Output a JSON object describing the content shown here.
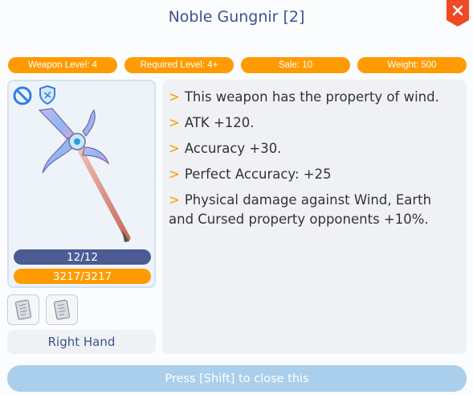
{
  "item": {
    "name": "Noble Gungnir [2]"
  },
  "stats": {
    "weapon_level": "Weapon Level: 4",
    "required_level": "Required Level: 4+",
    "sale": "Sale: 10",
    "weight": "Weight: 500"
  },
  "bars": {
    "refine": "12/12",
    "durability": "3217/3217"
  },
  "equip_position": "Right Hand",
  "description": [
    {
      "marker": ">",
      "text": "This weapon has the property of wind."
    },
    {
      "marker": ">",
      "text": "ATK +120."
    },
    {
      "marker": ">",
      "text": "Accuracy +30."
    },
    {
      "marker": ">",
      "text": "Perfect Accuracy: +25"
    },
    {
      "marker": ">",
      "text": "Physical damage against Wind, Earth and Cursed property opponents +10%."
    }
  ],
  "footer": {
    "close_hint": "Press [Shift] to close this"
  },
  "icons": {
    "close": "close-icon",
    "no_trade": "no-trade-icon",
    "shield": "shield-icon",
    "weapon": "spear-icon",
    "card": "card-slot-icon"
  },
  "colors": {
    "accent_orange": "#ff9b00",
    "title_blue": "#3d5291",
    "bar_blue": "#4b5b94",
    "close_red": "#ef4a24",
    "footer_button": "#aacfec"
  }
}
